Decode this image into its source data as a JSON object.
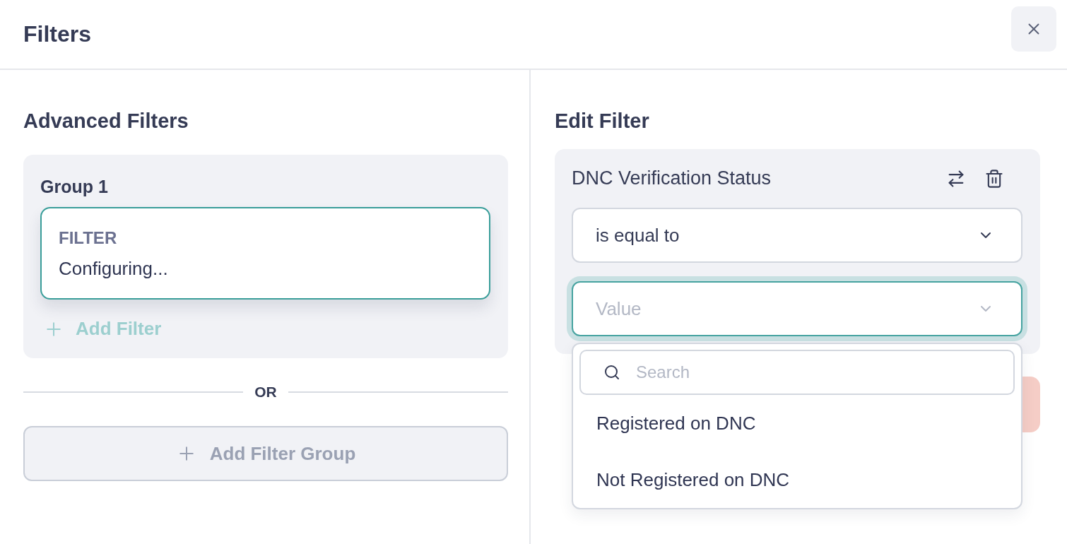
{
  "header": {
    "title": "Filters"
  },
  "advanced": {
    "title": "Advanced Filters",
    "groups": [
      {
        "title": "Group 1",
        "filters": [
          {
            "label": "FILTER",
            "status": "Configuring...",
            "selected": true
          }
        ],
        "add_filter": {
          "label": "Add Filter",
          "disabled": true
        }
      }
    ],
    "separator": "OR",
    "add_group": {
      "label": "Add Filter Group",
      "disabled": true
    }
  },
  "edit": {
    "title": "Edit Filter",
    "field": "DNC Verification Status",
    "operator": {
      "value": "is equal to"
    },
    "value_select": {
      "placeholder": "Value",
      "focused": true,
      "expanded": true,
      "search": {
        "placeholder": "Search"
      },
      "options": [
        {
          "label": "Registered on DNC",
          "selected": false
        },
        {
          "label": "Not Registered on DNC",
          "selected": false
        }
      ]
    }
  }
}
